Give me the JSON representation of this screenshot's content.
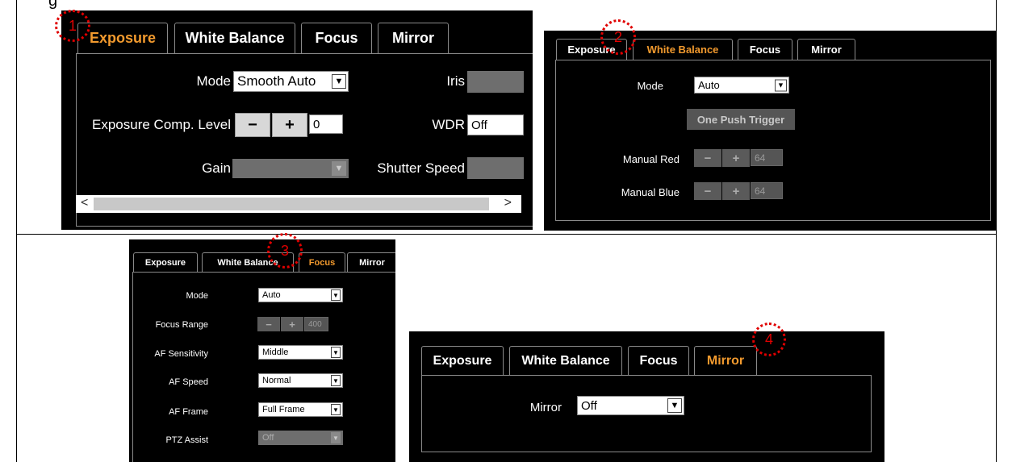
{
  "caption": "g",
  "callouts": [
    "1",
    "2",
    "3",
    "4"
  ],
  "p1": {
    "tabs": [
      "Exposure",
      "White Balance",
      "Focus",
      "Mirror"
    ],
    "mode_label": "Mode",
    "mode_value": "Smooth Auto",
    "iris_label": "Iris",
    "ecl_label": "Exposure Comp. Level",
    "ecl_minus": "−",
    "ecl_plus": "+",
    "ecl_value": "0",
    "wdr_label": "WDR",
    "wdr_value": "Off",
    "gain_label": "Gain",
    "shutter_label": "Shutter Speed",
    "scroll_left": "<",
    "scroll_right": ">"
  },
  "p2": {
    "tabs": [
      "Exposure",
      "White Balance",
      "Focus",
      "Mirror"
    ],
    "mode_label": "Mode",
    "mode_value": "Auto",
    "trigger": "One Push Trigger",
    "red_label": "Manual Red",
    "red_value": "64",
    "blue_label": "Manual Blue",
    "blue_value": "64",
    "minus": "−",
    "plus": "+"
  },
  "p3": {
    "tabs": [
      "Exposure",
      "White Balance",
      "Focus",
      "Mirror"
    ],
    "mode_label": "Mode",
    "mode_value": "Auto",
    "range_label": "Focus Range",
    "range_value": "400",
    "minus": "−",
    "plus": "+",
    "sens_label": "AF Sensitivity",
    "sens_value": "Middle",
    "speed_label": "AF Speed",
    "speed_value": "Normal",
    "frame_label": "AF Frame",
    "frame_value": "Full Frame",
    "ptz_label": "PTZ Assist",
    "ptz_value": "Off"
  },
  "p4": {
    "tabs": [
      "Exposure",
      "White Balance",
      "Focus",
      "Mirror"
    ],
    "mirror_label": "Mirror",
    "mirror_value": "Off"
  },
  "colors": {
    "active_tab": "#f29a2e",
    "callout": "#e00000"
  }
}
